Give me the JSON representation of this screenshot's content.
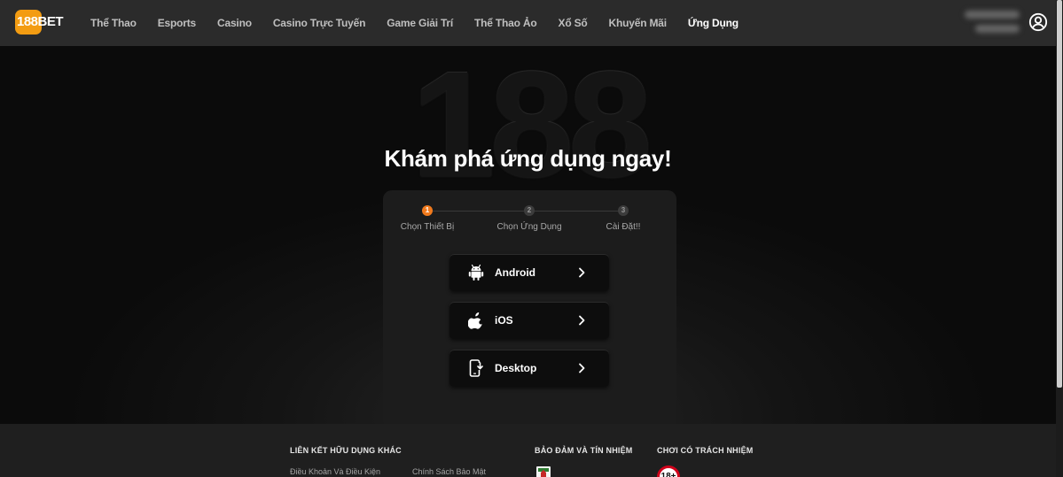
{
  "brand": {
    "logo_text": "188BET",
    "accent": "#f39c12"
  },
  "nav": {
    "items": [
      {
        "label": "Thể Thao",
        "active": false
      },
      {
        "label": "Esports",
        "active": false
      },
      {
        "label": "Casino",
        "active": false
      },
      {
        "label": "Casino Trực Tuyến",
        "active": false
      },
      {
        "label": "Game Giải Trí",
        "active": false
      },
      {
        "label": "Thể Thao Ảo",
        "active": false
      },
      {
        "label": "Xổ Số",
        "active": false
      },
      {
        "label": "Khuyến Mãi",
        "active": false
      },
      {
        "label": "Ứng Dụng",
        "active": true
      }
    ],
    "user_icon": "user-circle-icon"
  },
  "hero": {
    "background_logo_text": "188",
    "title": "Khám phá ứng dụng ngay!",
    "steps": [
      {
        "number": "1",
        "label": "Chọn Thiết Bị",
        "active": true
      },
      {
        "number": "2",
        "label": "Chọn Ứng Dụng",
        "active": false
      },
      {
        "number": "3",
        "label": "Cài Đặt!!",
        "active": false
      }
    ],
    "step_active_color": "#f07a1d",
    "options": [
      {
        "label": "Android",
        "icon": "android-icon"
      },
      {
        "label": "iOS",
        "icon": "apple-icon"
      },
      {
        "label": "Desktop",
        "icon": "device-download-icon"
      }
    ]
  },
  "footer": {
    "useful_links_heading": "LIÊN KẾT HỮU DỤNG KHÁC",
    "links": [
      "Điều Khoản Và Điều Kiện",
      "Chính Sách Bảo Mật"
    ],
    "trust_heading": "BẢO ĐẢM VÀ TÍN NHIỆM",
    "responsible_heading": "CHƠI CÓ TRÁCH NHIỆM",
    "age_badge": "18+"
  }
}
